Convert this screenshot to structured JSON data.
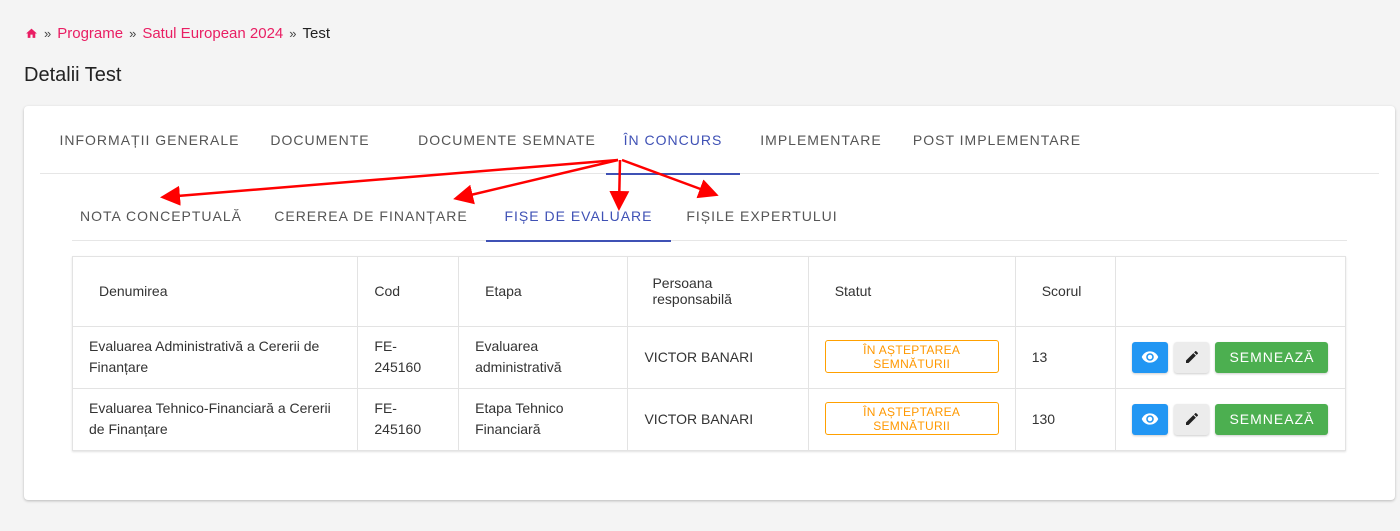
{
  "breadcrumb": {
    "separator": "»",
    "items": [
      "Programe",
      "Satul European 2024"
    ],
    "current": "Test"
  },
  "page": {
    "title": "Detalii Test"
  },
  "tabs": [
    {
      "label": "Informații generale"
    },
    {
      "label": "Documente"
    },
    {
      "label": "Documente semnate"
    },
    {
      "label": "În concurs",
      "active": true
    },
    {
      "label": "Implementare"
    },
    {
      "label": "Post implementare"
    }
  ],
  "subtabs": [
    {
      "label": "Nota conceptuală"
    },
    {
      "label": "Cererea de finanțare"
    },
    {
      "label": "Fișe de evaluare",
      "active": true
    },
    {
      "label": "Fișile expertului"
    }
  ],
  "table": {
    "headers": [
      "Denumirea",
      "Cod",
      "Etapa",
      "Persoana responsabilă",
      "Statut",
      "Scorul",
      ""
    ],
    "rows": [
      {
        "name": "Evaluarea Administrativă a Cererii de Finanțare",
        "code": "FE-245160",
        "stage": "Evaluarea administrativă",
        "person": "VICTOR BANARI",
        "status": "ÎN AȘTEPTAREA SEMNĂTURII",
        "score": "13",
        "sign_label": "SEMNEAZĂ"
      },
      {
        "name": "Evaluarea Tehnico-Financiară a Cererii de Finanțare",
        "code": "FE-245160",
        "stage": "Etapa Tehnico Financiară",
        "person": "VICTOR BANARI",
        "status": "ÎN AȘTEPTAREA SEMNĂTURII",
        "score": "130",
        "sign_label": "SEMNEAZĂ"
      }
    ]
  },
  "colors": {
    "accent": "#3f51b5",
    "link": "#e91e63",
    "status": "#ff9800",
    "view_button": "#2196f3",
    "sign_button": "#4caf50",
    "annotation_arrow": "#ff0000"
  },
  "icons": {
    "home": "home-icon",
    "view": "eye-icon",
    "edit": "pencil-icon"
  }
}
